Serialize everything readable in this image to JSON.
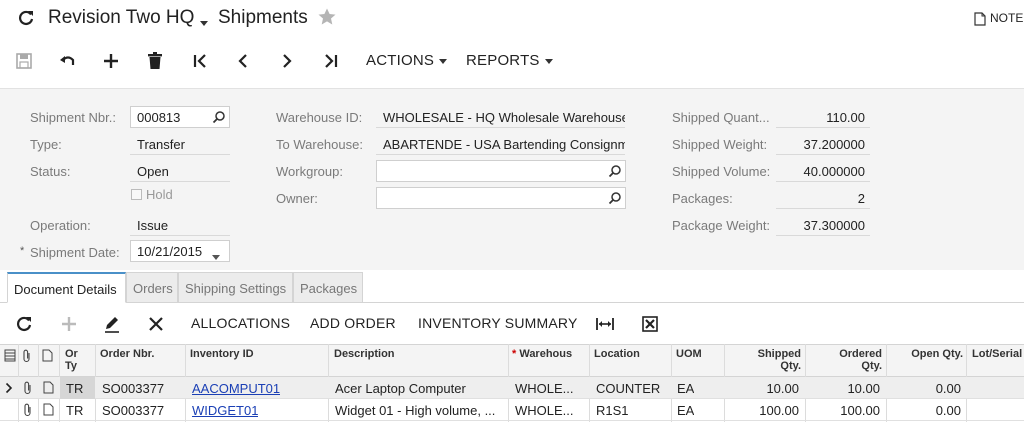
{
  "header": {
    "company": "Revision Two HQ",
    "screen": "Shipments",
    "notes": "NOTE"
  },
  "toolbar": {
    "actions_label": "ACTIONS",
    "reports_label": "REPORTS"
  },
  "form": {
    "shipment_nbr_label": "Shipment Nbr.:",
    "shipment_nbr": "000813",
    "type_label": "Type:",
    "type": "Transfer",
    "status_label": "Status:",
    "status": "Open",
    "hold_label": "Hold",
    "operation_label": "Operation:",
    "operation": "Issue",
    "shipment_date_label": "Shipment Date:",
    "shipment_date": "10/21/2015",
    "warehouse_id_label": "Warehouse ID:",
    "warehouse_id": "WHOLESALE - HQ Wholesale Warehouse",
    "to_warehouse_label": "To Warehouse:",
    "to_warehouse": "ABARTENDE - USA Bartending Consignment",
    "workgroup_label": "Workgroup:",
    "workgroup": "",
    "owner_label": "Owner:",
    "owner": "",
    "shipped_quantity_label": "Shipped Quant...",
    "shipped_quantity": "110.00",
    "shipped_weight_label": "Shipped Weight:",
    "shipped_weight": "37.200000",
    "shipped_volume_label": "Shipped Volume:",
    "shipped_volume": "40.000000",
    "packages_label": "Packages:",
    "packages": "2",
    "package_weight_label": "Package Weight:",
    "package_weight": "37.300000"
  },
  "tabs": [
    {
      "label": "Document Details",
      "active": true
    },
    {
      "label": "Orders"
    },
    {
      "label": "Shipping Settings"
    },
    {
      "label": "Packages"
    }
  ],
  "grid_toolbar": {
    "allocations": "ALLOCATIONS",
    "add_order": "ADD ORDER",
    "inventory_summary": "INVENTORY SUMMARY"
  },
  "grid": {
    "columns": {
      "or_ty": [
        "Or",
        "Ty"
      ],
      "order_nbr": "Order Nbr.",
      "inventory_id": "Inventory ID",
      "description": "Description",
      "warehouse": "Warehous",
      "location": "Location",
      "uom": "UOM",
      "shipped_qty": [
        "Shipped",
        "Qty."
      ],
      "ordered_qty": [
        "Ordered",
        "Qty."
      ],
      "open_qty": "Open Qty.",
      "lot_serial": "Lot/Serial"
    },
    "rows": [
      {
        "or_ty": "TR",
        "order_nbr": "SO003377",
        "inventory_id": "AACOMPUT01",
        "description": "Acer Laptop Computer",
        "warehouse": "WHOLE...",
        "location": "COUNTER",
        "uom": "EA",
        "shipped_qty": "10.00",
        "ordered_qty": "10.00",
        "open_qty": "0.00"
      },
      {
        "or_ty": "TR",
        "order_nbr": "SO003377",
        "inventory_id": "WIDGET01",
        "description": "Widget 01 - High volume, ...",
        "warehouse": "WHOLE...",
        "location": "R1S1",
        "uom": "EA",
        "shipped_qty": "100.00",
        "ordered_qty": "100.00",
        "open_qty": "0.00"
      }
    ]
  },
  "colors": {
    "accent": "#4a90c8",
    "link": "#1a3fb5",
    "required": "#cc0000"
  }
}
